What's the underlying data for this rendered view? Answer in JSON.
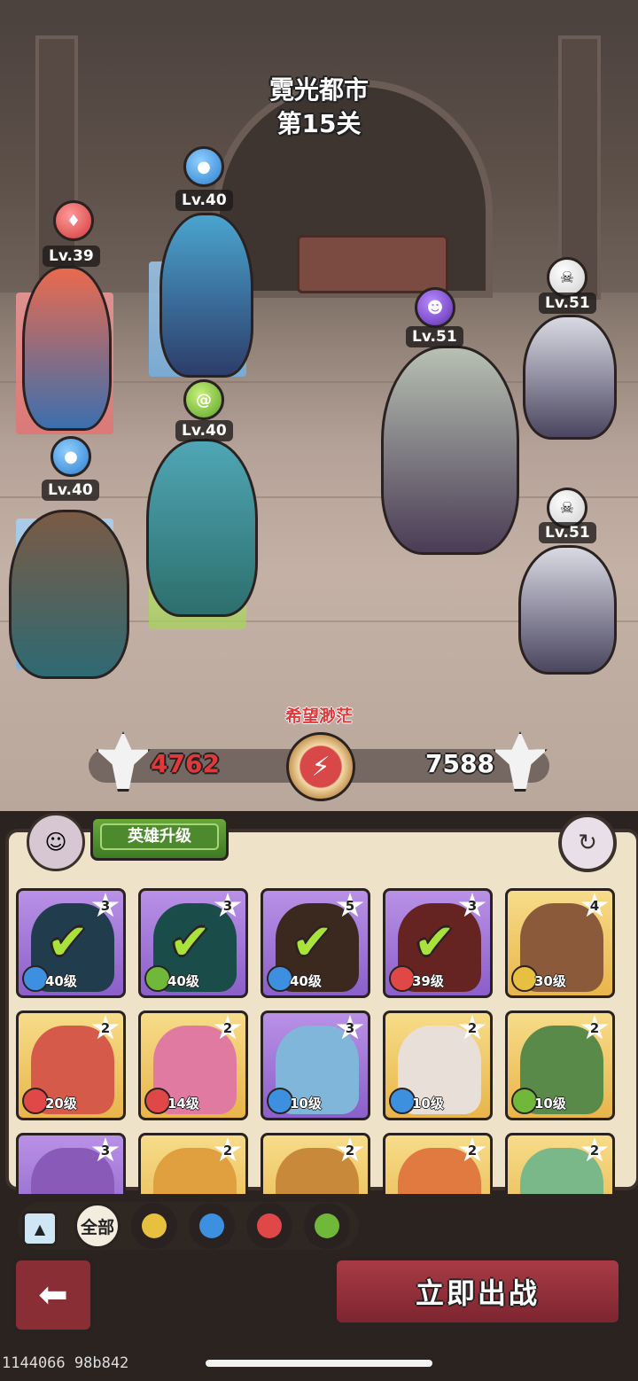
{
  "stage": {
    "city": "霓光都市",
    "level": "第15关"
  },
  "allies": [
    {
      "level": "Lv.39",
      "element": "fire"
    },
    {
      "level": "Lv.40",
      "element": "water"
    },
    {
      "level": "Lv.40",
      "element": "wind"
    },
    {
      "level": "Lv.40",
      "element": "water"
    }
  ],
  "enemies": [
    {
      "level": "Lv.51",
      "type": "boss"
    },
    {
      "level": "Lv.51",
      "type": "minion"
    },
    {
      "level": "Lv.51",
      "type": "minion"
    }
  ],
  "battle": {
    "synergy": "希望渺茫",
    "ally_power": "4762",
    "enemy_power": "7588"
  },
  "panel": {
    "upgrade_tab": "英雄升级"
  },
  "heroes": [
    {
      "stars": "3",
      "level": "40级",
      "element": "water",
      "selected": true,
      "rarity": "purple"
    },
    {
      "stars": "3",
      "level": "40级",
      "element": "wind",
      "selected": true,
      "rarity": "purple"
    },
    {
      "stars": "5",
      "level": "40级",
      "element": "water",
      "selected": true,
      "rarity": "purple"
    },
    {
      "stars": "3",
      "level": "39级",
      "element": "fire",
      "selected": true,
      "rarity": "purple"
    },
    {
      "stars": "4",
      "level": "30级",
      "element": "earth",
      "selected": false,
      "rarity": "gold"
    },
    {
      "stars": "2",
      "level": "20级",
      "element": "fire",
      "selected": false,
      "rarity": "gold"
    },
    {
      "stars": "2",
      "level": "14级",
      "element": "fire",
      "selected": false,
      "rarity": "gold"
    },
    {
      "stars": "3",
      "level": "10级",
      "element": "water",
      "selected": false,
      "rarity": "purple"
    },
    {
      "stars": "2",
      "level": "10级",
      "element": "water",
      "selected": false,
      "rarity": "gold"
    },
    {
      "stars": "2",
      "level": "10级",
      "element": "wind",
      "selected": false,
      "rarity": "gold"
    },
    {
      "stars": "3",
      "level": "",
      "element": "",
      "selected": false,
      "rarity": "purple"
    },
    {
      "stars": "2",
      "level": "",
      "element": "",
      "selected": false,
      "rarity": "gold"
    },
    {
      "stars": "2",
      "level": "",
      "element": "",
      "selected": false,
      "rarity": "gold"
    },
    {
      "stars": "2",
      "level": "",
      "element": "",
      "selected": false,
      "rarity": "gold"
    },
    {
      "stars": "2",
      "level": "",
      "element": "",
      "selected": false,
      "rarity": "gold"
    }
  ],
  "filters": {
    "all_label": "全部",
    "options": [
      "earth",
      "water",
      "fire",
      "wind"
    ]
  },
  "actions": {
    "start_battle": "立即出战"
  },
  "debug": "1144066 98b842",
  "colors": {
    "water": "#3d8fe0",
    "fire": "#e04848",
    "wind": "#6fb83a",
    "earth": "#e8c040",
    "accent_red": "#e0393b"
  }
}
